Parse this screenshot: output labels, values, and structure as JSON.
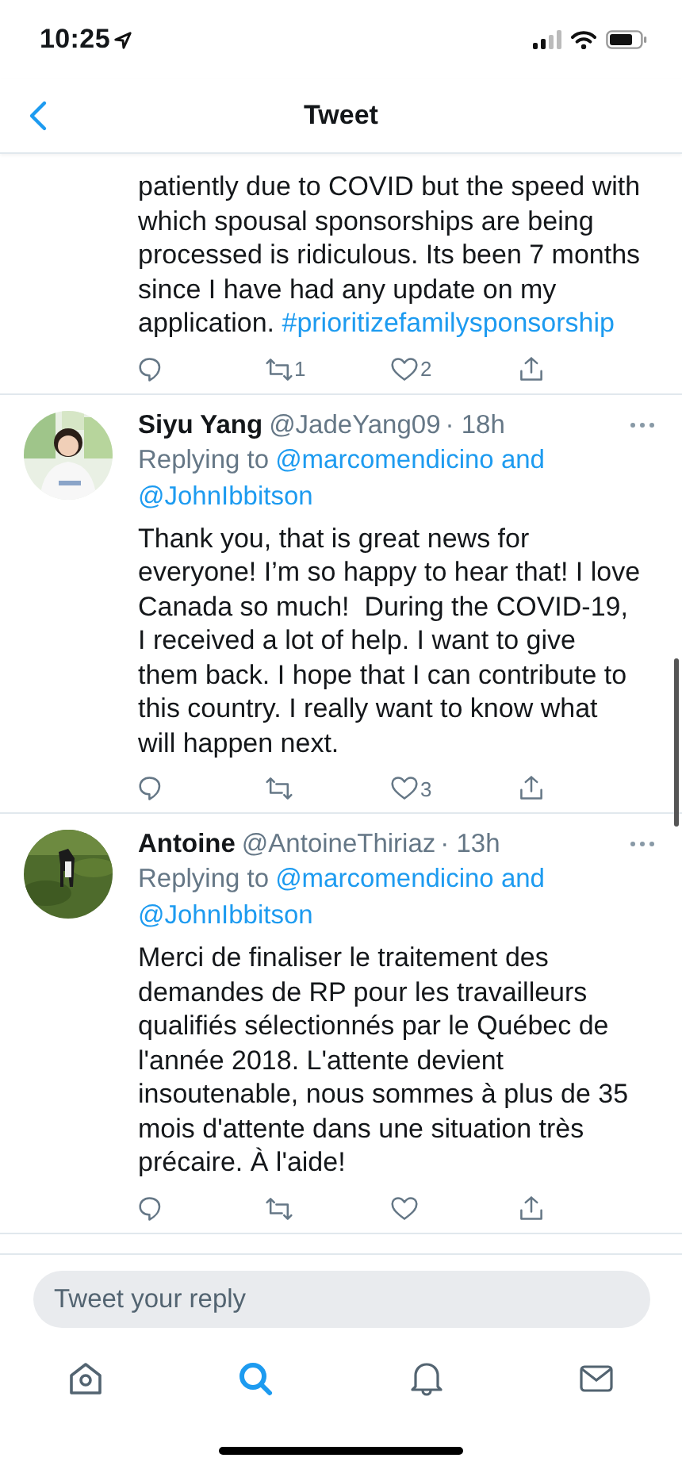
{
  "status_bar": {
    "time": "10:25"
  },
  "header": {
    "title": "Tweet"
  },
  "tweets": [
    {
      "body": [
        {
          "kind": "text",
          "text": "patiently due to COVID but the speed with which spousal sponsorships are being processed is ridiculous. Its been 7 months since I have had any update on my application. "
        },
        {
          "kind": "hashtag",
          "text": "#prioritizefamilysponsorship"
        }
      ],
      "actions": {
        "retweets": "1",
        "likes": "2"
      }
    },
    {
      "avatar": {
        "kind": "picture"
      },
      "name": "Siyu Yang",
      "handle": "@JadeYang09",
      "time": "· 18h",
      "replying": {
        "label": "Replying to",
        "mentions": [
          "@marcomendicino and",
          "@JohnIbbitson"
        ]
      },
      "body": [
        {
          "kind": "text",
          "text": "Thank you, that is great news for everyone! I’m so happy to hear that! I love Canada so much!  During the COVID-19, I received a lot of help. I want to give them back. I hope that I can contribute to this country. I really want to know what will happen next."
        }
      ],
      "actions": {
        "likes": "3"
      }
    },
    {
      "avatar": {
        "kind": "picture"
      },
      "name": "Antoine",
      "handle": "@AntoineThiriaz",
      "time": "· 13h",
      "replying": {
        "label": "Replying to",
        "mentions": [
          "@marcomendicino and",
          "@JohnIbbitson"
        ]
      },
      "body": [
        {
          "kind": "text",
          "text": "Merci de finaliser le traitement des demandes de RP pour les travailleurs qualifiés sélectionnés par le Québec de l'année 2018. L'attente devient insoutenable, nous sommes à plus de 35 mois d'attente dans une situation très précaire. À l'aide!"
        }
      ]
    }
  ],
  "reply_field": {
    "placeholder": "Tweet your reply"
  },
  "tab_bar": [
    {
      "kind": "home",
      "selected": false
    },
    {
      "kind": "search",
      "selected": true
    },
    {
      "kind": "notifications",
      "selected": false
    },
    {
      "kind": "messages",
      "selected": false
    }
  ]
}
